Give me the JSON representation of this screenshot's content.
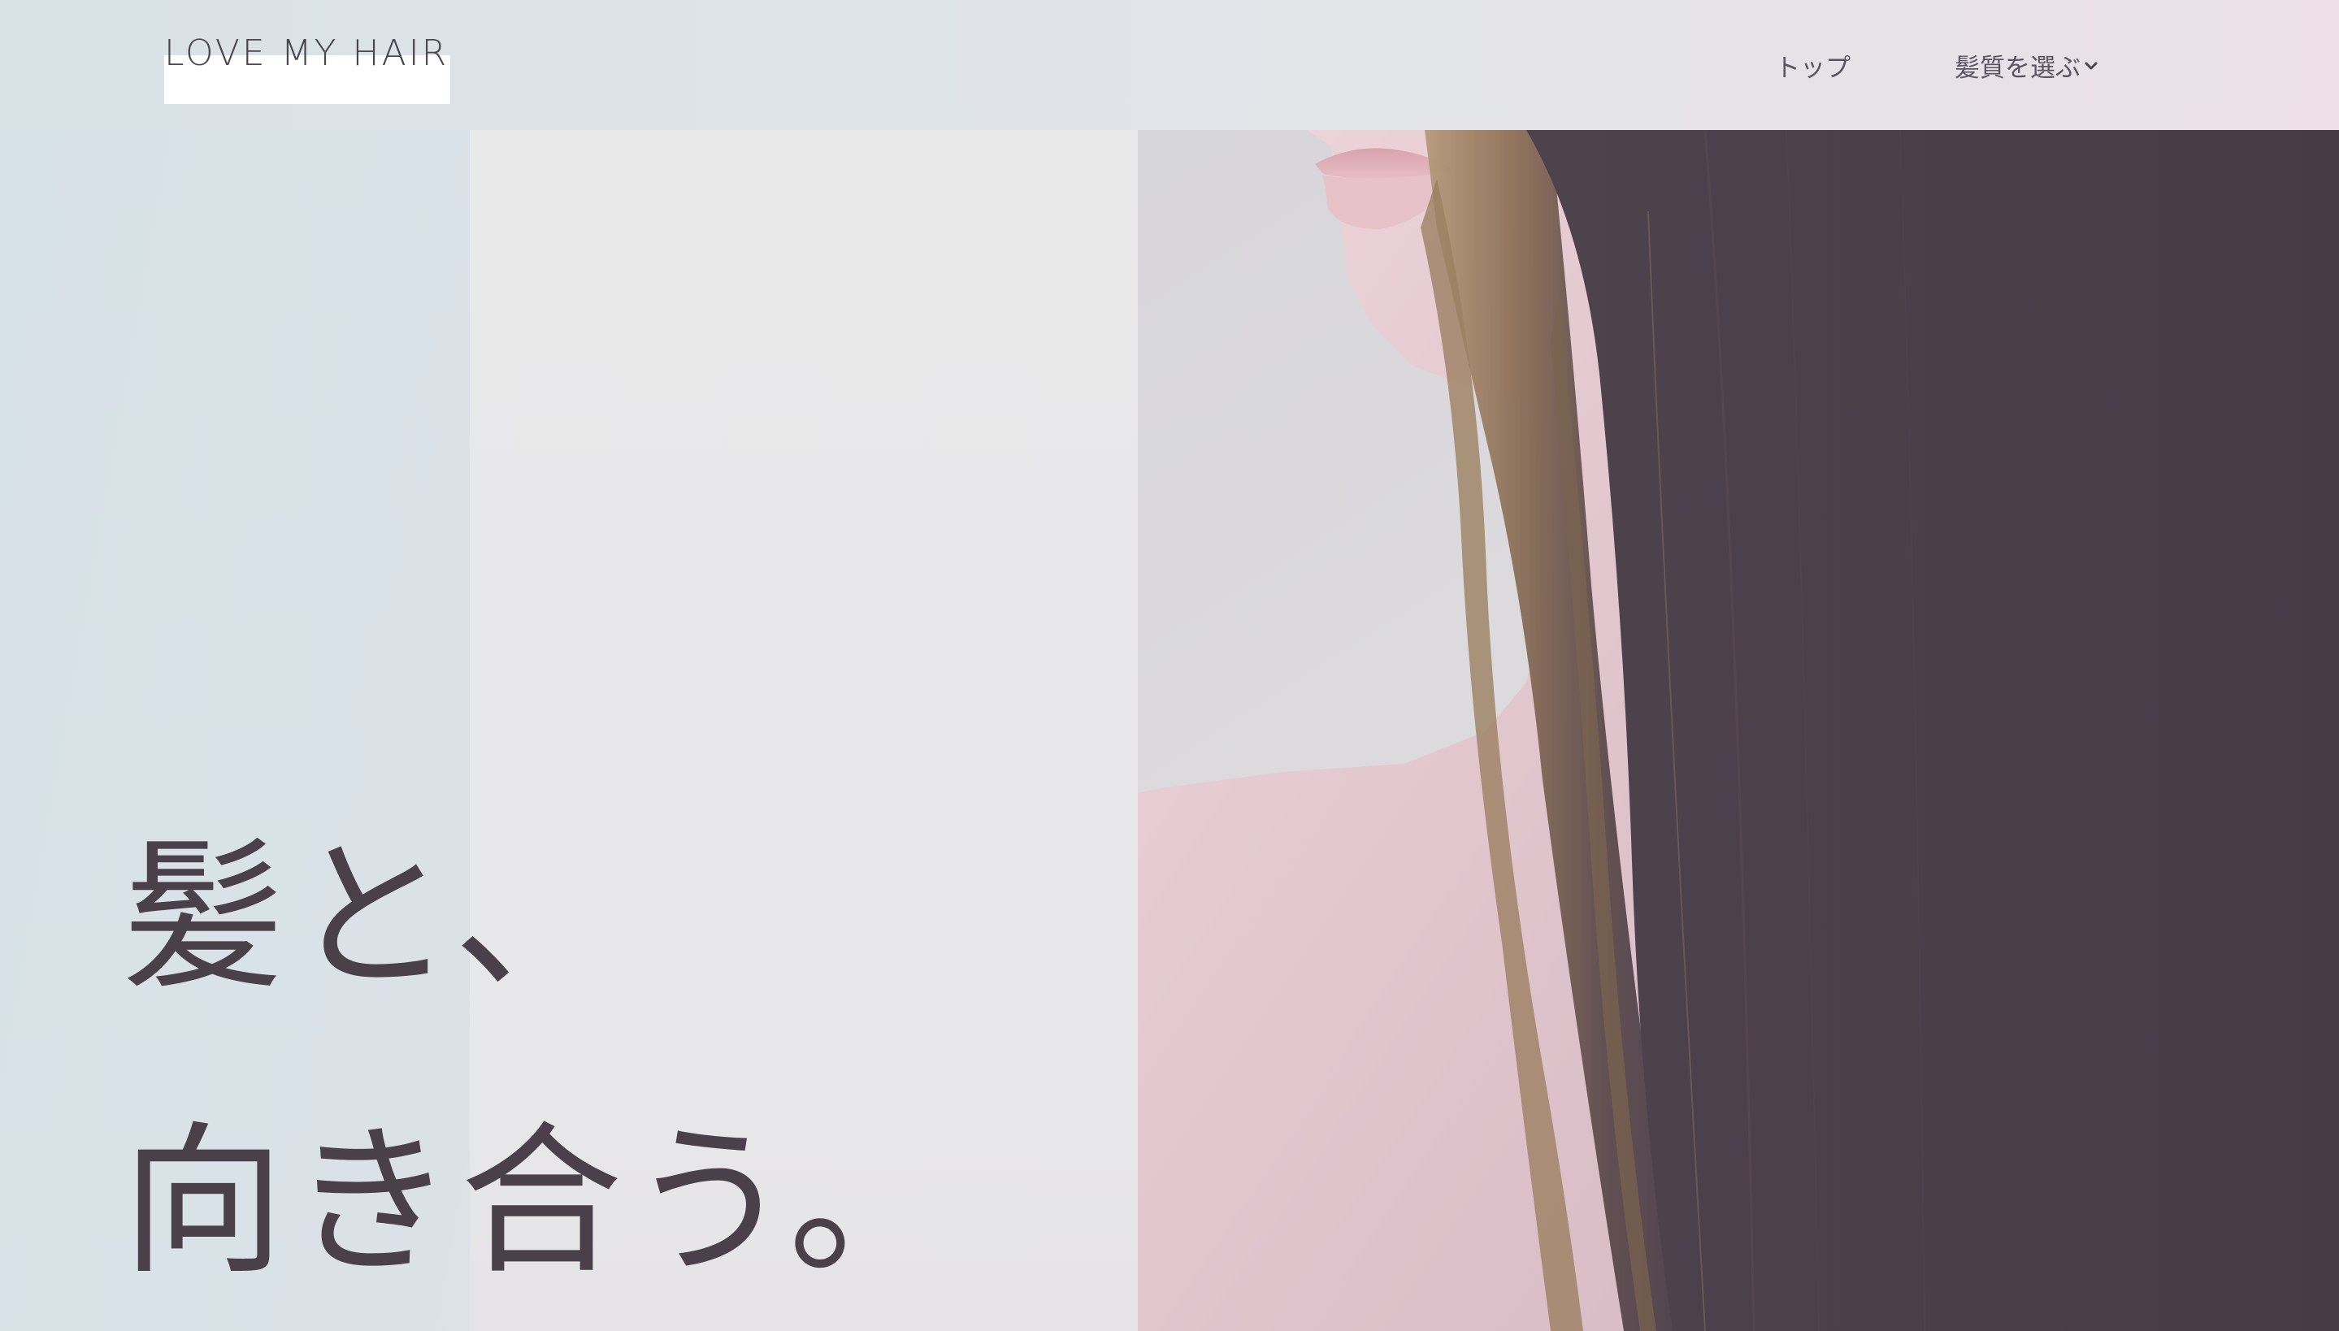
{
  "header": {
    "logo_text": "LOVE MY HAIR",
    "nav": [
      {
        "label": "トップ"
      },
      {
        "label": "髪質を選ぶ",
        "has_dropdown": true,
        "icon": "chevron-down-icon"
      }
    ]
  },
  "hero": {
    "headline_line1": "髪と、",
    "headline_line2": "向き合う。",
    "image_description_icon": "hero-portrait-image"
  },
  "colors": {
    "text": "#4a4049",
    "hair_dark": "#4a3e4a",
    "panel": "#e9e9ea",
    "background_start": "#d6e1e7",
    "background_end": "#ecdfe6"
  }
}
